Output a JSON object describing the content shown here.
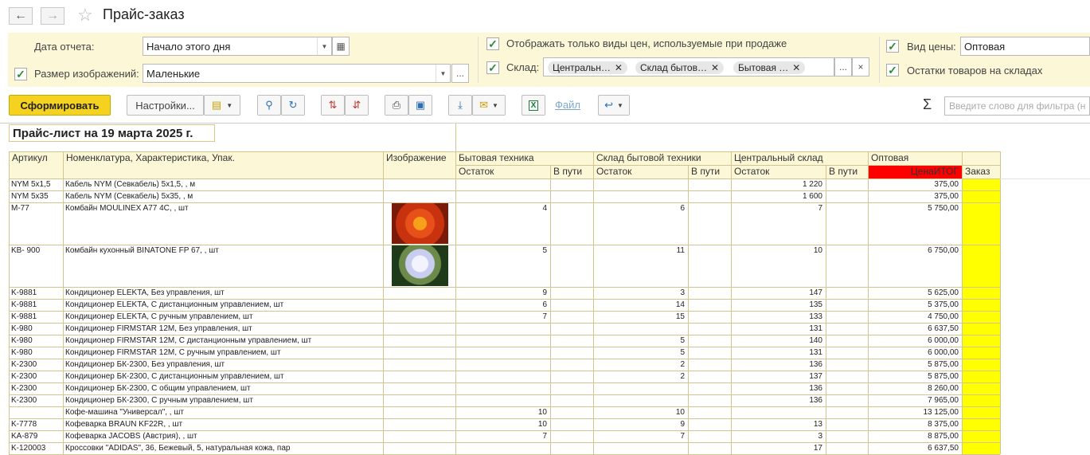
{
  "window": {
    "title": "Прайс-заказ",
    "nav_back": "←",
    "nav_forward": "→"
  },
  "params": {
    "report_date_label": "Дата отчета:",
    "report_date_value": "Начало этого дня",
    "image_size_label": "Размер изображений:",
    "image_size_value": "Маленькие",
    "only_sale_prices_label": "Отображать только виды цен, используемые при продаже",
    "warehouse_label": "Склад:",
    "warehouse_tags": [
      "Центральн…",
      "Склад бытов…",
      "Бытовая …"
    ],
    "price_type_label": "Вид цены:",
    "price_type_value": "Оптовая",
    "stock_label": "Остатки товаров на складах",
    "ellipsis": "...",
    "clear": "×"
  },
  "toolbar": {
    "generate": "Сформировать",
    "settings": "Настройки...",
    "file_link": "Файл",
    "sigma": "Σ",
    "filter_placeholder": "Введите слово для фильтра (н"
  },
  "report": {
    "title": "Прайс-лист на 19 марта 2025 г.",
    "headers": {
      "article": "Артикул",
      "nomenclature": "Номенклатура, Характеристика, Упак.",
      "image": "Изображение",
      "wh1": "Бытовая техника",
      "wh2": "Склад бытовой техники",
      "wh3": "Центральный склад",
      "price_type": "Оптовая",
      "stock": "Остаток",
      "in_transit": "В пути",
      "price_total": "ЦенаИТОГ",
      "order": "Заказ"
    },
    "rows": [
      {
        "article": "NYM 5x1,5",
        "name": "Кабель NYM (Севкабель) 5x1,5, , м",
        "s1": "",
        "s2": "",
        "s3": "1 220",
        "price": "375,00"
      },
      {
        "article": "NYM 5x35",
        "name": "Кабель NYM (Севкабель) 5x35, , м",
        "s1": "",
        "s2": "",
        "s3": "1 600",
        "price": "375,00"
      },
      {
        "article": "M-77",
        "name": "Комбайн MOULINEX  A77 4C, , шт",
        "s1": "4",
        "s2": "6",
        "s3": "7",
        "price": "5 750,00",
        "image": "orange-flower"
      },
      {
        "article": "KB- 900",
        "name": "Комбайн кухонный BINATONE FP 67, , шт",
        "s1": "5",
        "s2": "11",
        "s3": "10",
        "price": "6 750,00",
        "image": "white-flower"
      },
      {
        "article": "K-9881",
        "name": "Кондиционер ELEKTA, Без управления, шт",
        "s1": "9",
        "s2": "3",
        "s3": "147",
        "price": "5 625,00"
      },
      {
        "article": "K-9881",
        "name": "Кондиционер ELEKTA, С дистанционным управлением, шт",
        "s1": "6",
        "s2": "14",
        "s3": "135",
        "price": "5 375,00"
      },
      {
        "article": "K-9881",
        "name": "Кондиционер ELEKTA, С ручным управлением, шт",
        "s1": "7",
        "s2": "15",
        "s3": "133",
        "price": "4 750,00"
      },
      {
        "article": "K-980",
        "name": "Кондиционер FIRMSTAR 12M, Без управления, шт",
        "s1": "",
        "s2": "",
        "s3": "131",
        "price": "6 637,50"
      },
      {
        "article": "K-980",
        "name": "Кондиционер FIRMSTAR 12M, С дистанционным управлением, шт",
        "s1": "",
        "s2": "5",
        "s3": "140",
        "price": "6 000,00"
      },
      {
        "article": "K-980",
        "name": "Кондиционер FIRMSTAR 12M, С ручным управлением, шт",
        "s1": "",
        "s2": "5",
        "s3": "131",
        "price": "6 000,00"
      },
      {
        "article": "K-2300",
        "name": "Кондиционер БК-2300, Без управления, шт",
        "s1": "",
        "s2": "2",
        "s3": "136",
        "price": "5 875,00"
      },
      {
        "article": "K-2300",
        "name": "Кондиционер БК-2300, С дистанционным управлением, шт",
        "s1": "",
        "s2": "2",
        "s3": "137",
        "price": "5 875,00"
      },
      {
        "article": "K-2300",
        "name": "Кондиционер БК-2300, С общим управлением, шт",
        "s1": "",
        "s2": "",
        "s3": "136",
        "price": "8 260,00"
      },
      {
        "article": "K-2300",
        "name": "Кондиционер БК-2300, С ручным управлением, шт",
        "s1": "",
        "s2": "",
        "s3": "136",
        "price": "7 965,00"
      },
      {
        "article": "",
        "name": "Кофе-машина \"Универсал\", , шт",
        "s1": "10",
        "s2": "10",
        "s3": "",
        "price": "13 125,00"
      },
      {
        "article": "K-7778",
        "name": "Кофеварка BRAUN KF22R, , шт",
        "s1": "10",
        "s2": "9",
        "s3": "13",
        "price": "8 375,00"
      },
      {
        "article": "KA-879",
        "name": "Кофеварка JACOBS (Австрия), , шт",
        "s1": "7",
        "s2": "7",
        "s3": "3",
        "price": "8 875,00"
      },
      {
        "article": "K-120003",
        "name": "Кроссовки \"ADIDAS\", 36, Бежевый, 5, натуральная кожа, пар",
        "s1": "",
        "s2": "",
        "s3": "17",
        "price": "6 637,50"
      }
    ]
  },
  "colors": {
    "accent": "#f5d21f",
    "panel": "#fbf7d7",
    "order": "#ffff00",
    "price_header": "#ff0000"
  }
}
